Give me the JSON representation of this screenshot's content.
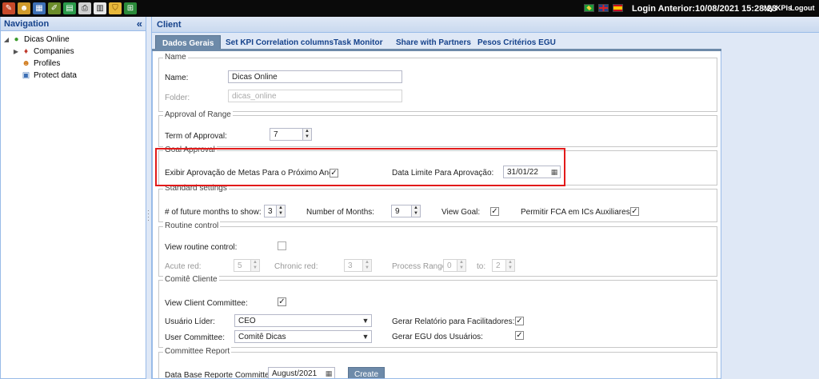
{
  "topbar": {
    "icons": [
      "tools-icon",
      "users-icon",
      "calendar-icon",
      "pen-icon",
      "chart-icon",
      "print-icon",
      "document-icon",
      "shield-icon",
      "excel-icon"
    ],
    "languages": [
      "pt-BR",
      "en-GB",
      "es"
    ],
    "login_text": "Login Anterior:10/08/2021 15:28:23",
    "my_kpis": "My KPIs",
    "logout": "Logout"
  },
  "navigation": {
    "title": "Navigation",
    "collapse": "«",
    "items": [
      {
        "label": "Dicas Online",
        "icon": "client-icon"
      },
      {
        "label": "Companies",
        "icon": "companies-icon"
      },
      {
        "label": "Profiles",
        "icon": "profiles-icon"
      },
      {
        "label": "Protect data",
        "icon": "protect-data-icon"
      }
    ]
  },
  "client": {
    "title": "Client",
    "tabs": [
      {
        "label": "Dados Gerais",
        "active": true
      },
      {
        "label": "Set KPI Correlation columns"
      },
      {
        "label": "Task Monitor"
      },
      {
        "label": "Share with Partners"
      },
      {
        "label": "Pesos Critérios EGU"
      }
    ]
  },
  "sections": {
    "name": {
      "legend": "Name",
      "name_label": "Name:",
      "name_value": "Dicas Online",
      "folder_label": "Folder:",
      "folder_value": "dicas_online"
    },
    "approval_range": {
      "legend": "Approval of Range",
      "term_label": "Term of Approval:",
      "term_value": "7"
    },
    "goal_approval": {
      "legend": "Goal Approval",
      "show_next_year_label": "Exibir Aprovação de Metas Para o Próximo Ano:",
      "show_next_year_checked": true,
      "deadline_label": "Data Limite Para Aprovação:",
      "deadline_value": "31/01/22"
    },
    "standard": {
      "legend": "Standard settings",
      "future_months_label": "# of future months to show:",
      "future_months_value": "3",
      "months_label": "Number of Months:",
      "months_value": "9",
      "view_goal_label": "View Goal:",
      "view_goal_checked": true,
      "fca_label": "Permitir FCA em ICs Auxiliares:",
      "fca_checked": true
    },
    "routine": {
      "legend": "Routine control",
      "view_label": "View routine control:",
      "view_checked": false,
      "acute_label": "Acute red:",
      "acute_value": "5",
      "chronic_label": "Chronic red:",
      "chronic_value": "3",
      "process_label": "Process Range:",
      "process_from": "0",
      "to_label": "to:",
      "process_to": "2"
    },
    "committee": {
      "legend": "Comitê Cliente",
      "view_label": "View Client Committee:",
      "view_checked": true,
      "leader_label": "Usuário Líder:",
      "leader_value": "CEO",
      "user_committee_label": "User Committee:",
      "user_committee_value": "Comitê Dicas",
      "report_label": "Gerar Relatório para Facilitadores:",
      "report_checked": true,
      "egu_label": "Gerar EGU dos Usuários:",
      "egu_checked": true
    },
    "committee_report": {
      "legend": "Committee Report",
      "date_label": "Data Base Reporte Committe:",
      "date_value": "August/2021",
      "create_label": "Create"
    }
  }
}
